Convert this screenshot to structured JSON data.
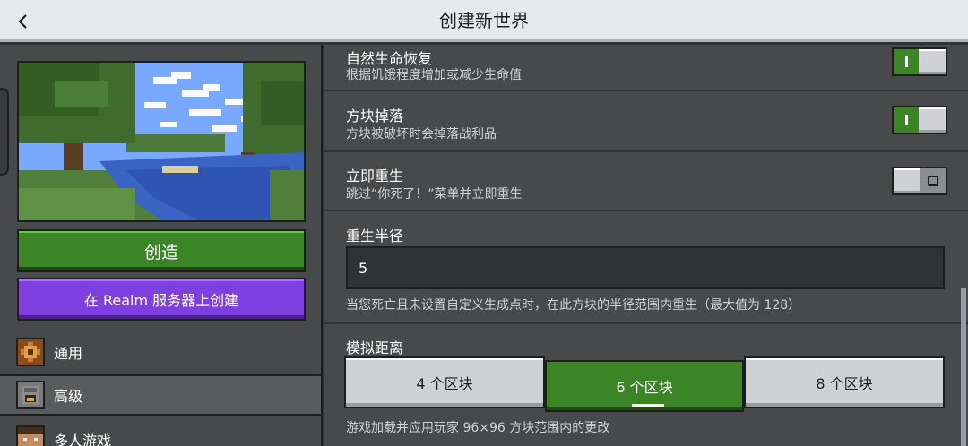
{
  "header": {
    "title": "创建新世界",
    "back_icon": "chevron-left-icon"
  },
  "left": {
    "create_label": "创造",
    "realm_label": "在 Realm 服务器上创建",
    "nav": [
      {
        "label": "通用",
        "icon": "gear-icon"
      },
      {
        "label": "高级",
        "icon": "furnace-icon"
      },
      {
        "label": "多人游戏",
        "icon": "player-head-icon"
      }
    ]
  },
  "settings": {
    "natural_regen": {
      "title": "自然生命恢复",
      "desc": "根据饥饿程度增加或减少生命值",
      "enabled": true
    },
    "tile_drops": {
      "title": "方块掉落",
      "desc": "方块被破坏时会掉落战利品",
      "enabled": true
    },
    "immediate_respawn": {
      "title": "立即重生",
      "desc": "跳过“你死了！”菜单并立即重生",
      "enabled": false
    },
    "respawn_radius": {
      "title": "重生半径",
      "value": "5",
      "desc": "当您死亡且未设置自定义生成点时，在此方块的半径范围内重生（最大值为 128）"
    },
    "simulation_distance": {
      "title": "模拟距离",
      "options": [
        "4 个区块",
        "6 个区块",
        "8 个区块"
      ],
      "selected": "6 个区块",
      "desc": "游戏加载并应用玩家 96×96 方块范围内的更改"
    }
  },
  "colors": {
    "accent_green": "#3c8527",
    "realm_purple": "#7f3fe0",
    "panel": "#48494a",
    "header": "#e6e8eb"
  }
}
